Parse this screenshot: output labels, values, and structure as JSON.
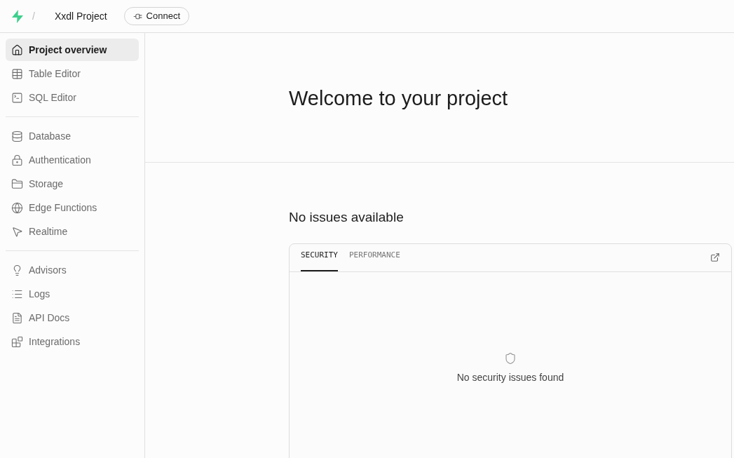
{
  "header": {
    "separator": "/",
    "project": "Xxdl Project",
    "connect_button": "Connect"
  },
  "sidebar": {
    "groups": [
      {
        "items": [
          {
            "label": "Project overview",
            "selected": true
          },
          {
            "label": "Table Editor",
            "selected": false
          },
          {
            "label": "SQL Editor",
            "selected": false
          }
        ]
      },
      {
        "items": [
          {
            "label": "Database",
            "selected": false
          },
          {
            "label": "Authentication",
            "selected": false
          },
          {
            "label": "Storage",
            "selected": false
          },
          {
            "label": "Edge Functions",
            "selected": false
          },
          {
            "label": "Realtime",
            "selected": false
          }
        ]
      },
      {
        "items": [
          {
            "label": "Advisors",
            "selected": false
          },
          {
            "label": "Logs",
            "selected": false
          },
          {
            "label": "API Docs",
            "selected": false
          },
          {
            "label": "Integrations",
            "selected": false
          }
        ]
      }
    ]
  },
  "main": {
    "title": "Welcome to your project",
    "issues_heading": "No issues available",
    "card": {
      "tabs": [
        {
          "label": "SECURITY",
          "selected": true
        },
        {
          "label": "PERFORMANCE",
          "selected": false
        }
      ],
      "empty_message": "No security issues found"
    }
  }
}
